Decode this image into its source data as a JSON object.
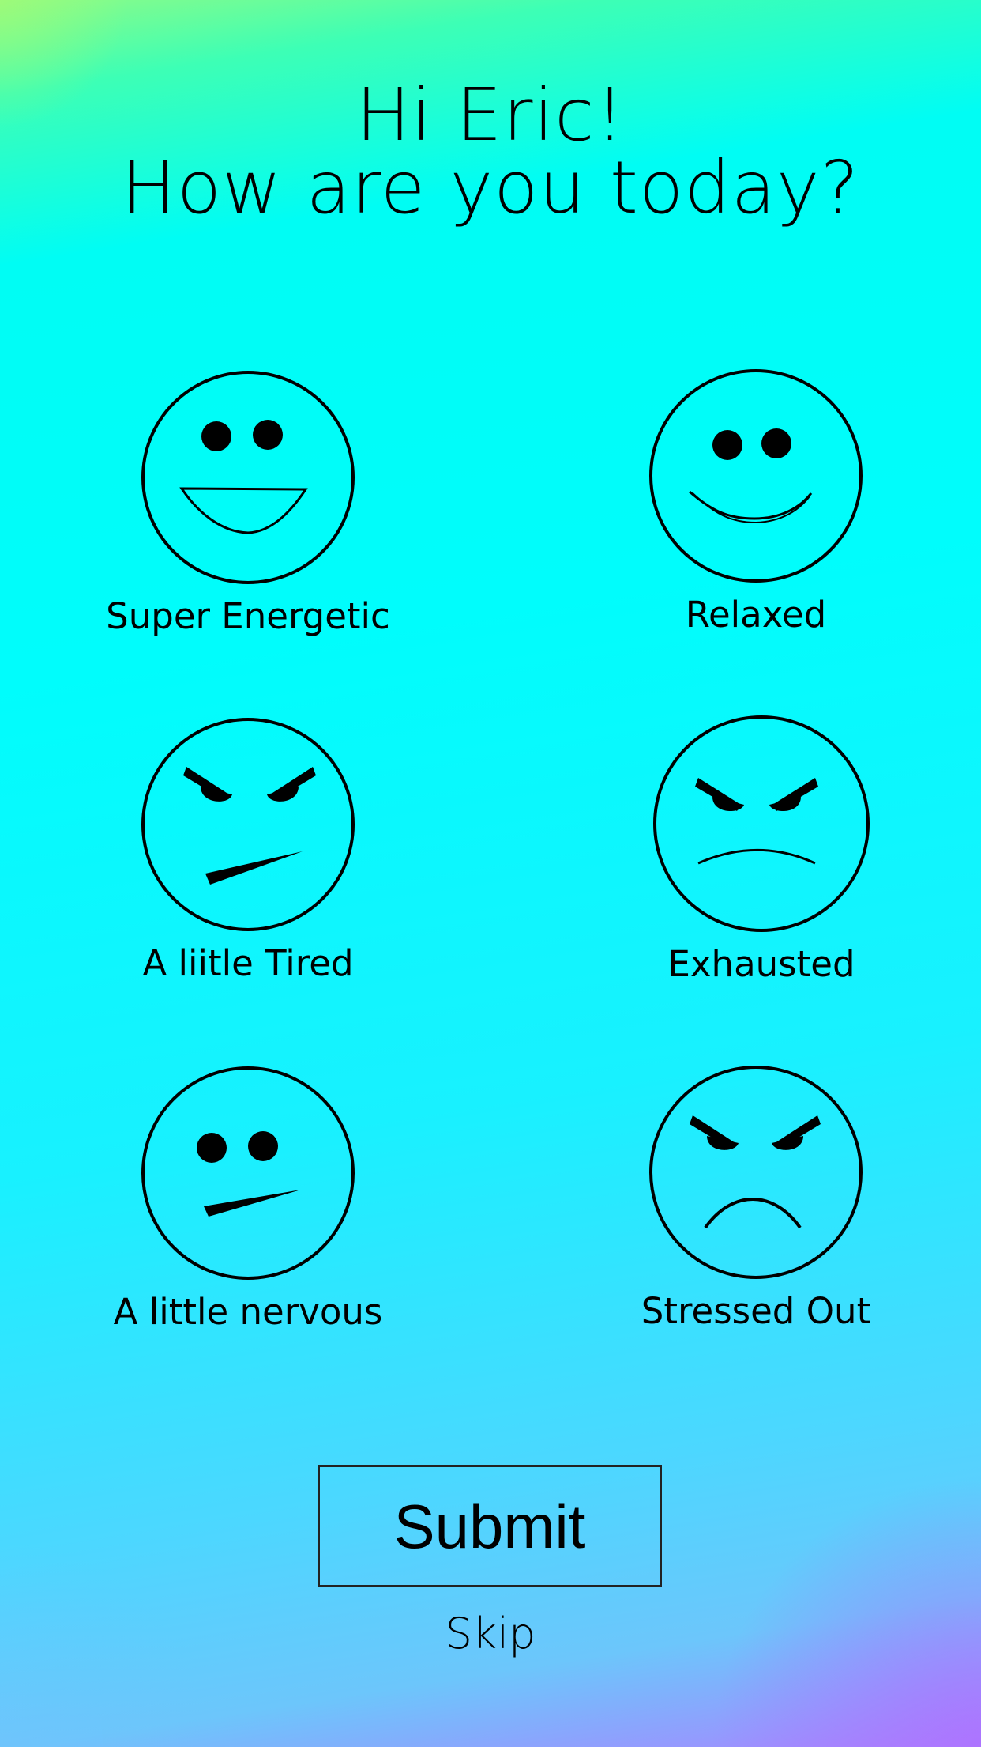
{
  "greeting": {
    "line1": "Hi Eric!",
    "line2": "How are you today?"
  },
  "moods": [
    {
      "label": "Super Energetic",
      "icon": "super-energetic-face-icon"
    },
    {
      "label": "Relaxed",
      "icon": "relaxed-face-icon"
    },
    {
      "label": "A liitle Tired",
      "icon": "a-little-tired-face-icon"
    },
    {
      "label": "Exhausted",
      "icon": "exhausted-face-icon"
    },
    {
      "label": "A little nervous",
      "icon": "a-little-nervous-face-icon"
    },
    {
      "label": "Stressed Out",
      "icon": "stressed-out-face-icon"
    }
  ],
  "actions": {
    "submit_label": "Submit",
    "skip_label": "Skip"
  }
}
